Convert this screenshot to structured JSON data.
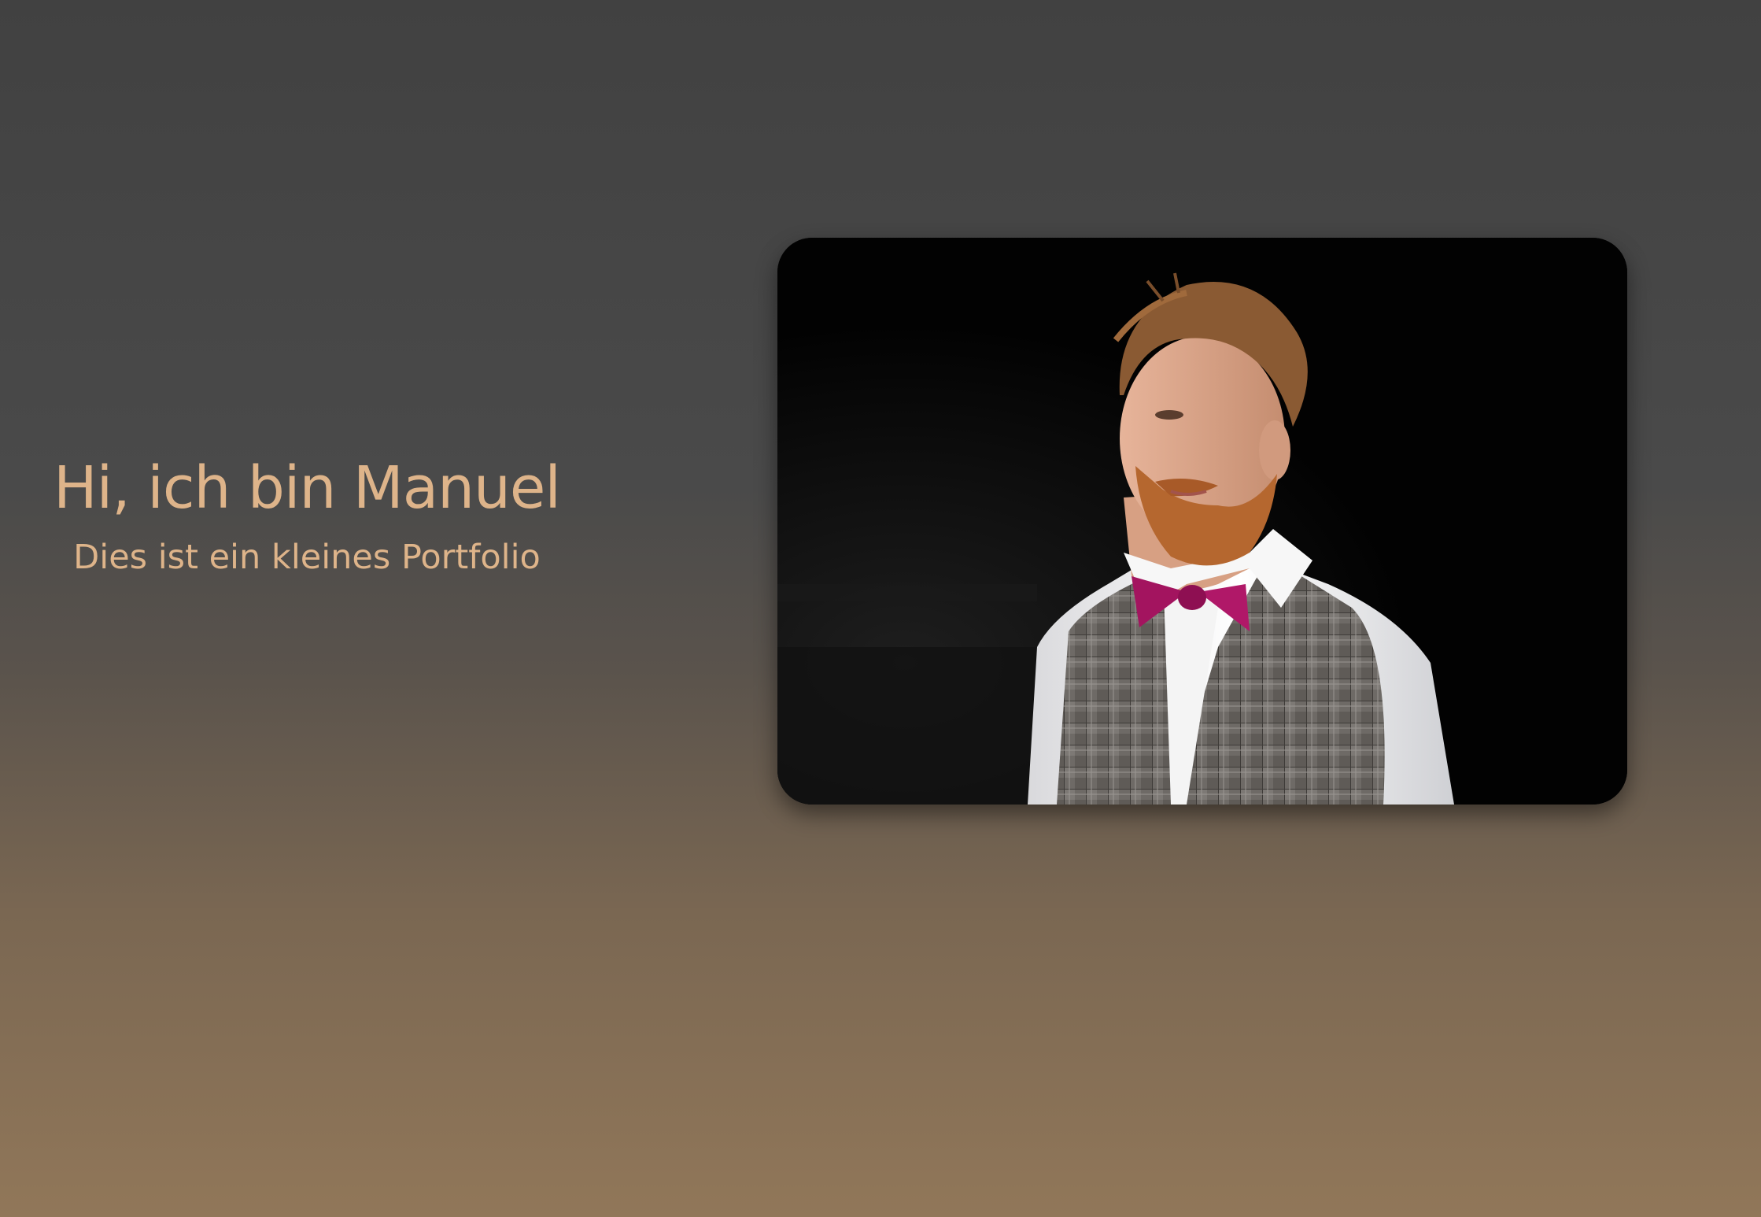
{
  "hero": {
    "title": "Hi, ich bin Manuel",
    "subtitle": "Dies ist ein kleines Portfolio",
    "photo_alt": "portrait-photo"
  },
  "colors": {
    "accent": "#deb48a",
    "background_top": "#414141",
    "background_bottom": "#917759"
  }
}
